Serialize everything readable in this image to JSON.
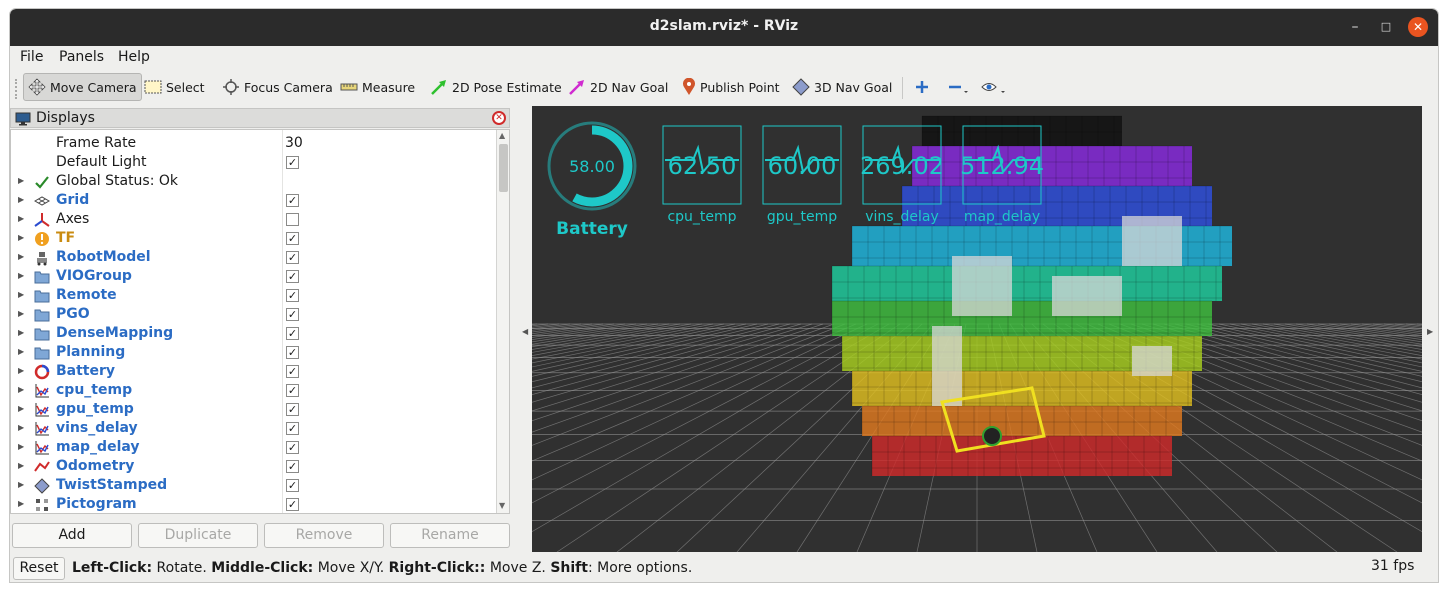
{
  "window": {
    "title": "d2slam.rviz* - RViz",
    "min_icon": "minimize-icon",
    "max_icon": "maximize-icon",
    "close_icon": "close-icon"
  },
  "menu": {
    "file": "File",
    "panels": "Panels",
    "help": "Help"
  },
  "toolbar": {
    "move_camera": "Move Camera",
    "select": "Select",
    "focus_camera": "Focus Camera",
    "measure": "Measure",
    "pose_estimate": "2D Pose Estimate",
    "nav_goal": "2D Nav Goal",
    "publish_point": "Publish Point",
    "nav_goal_3d": "3D Nav Goal"
  },
  "displays": {
    "title": "Displays",
    "rows": [
      {
        "name": "Frame Rate",
        "value": "30",
        "style": "plain",
        "icon": ""
      },
      {
        "name": "Default Light",
        "checked": true,
        "style": "plain",
        "icon": ""
      },
      {
        "name": "Global Status: Ok",
        "style": "plain",
        "icon": "check-icon",
        "expandable": true
      },
      {
        "name": "Grid",
        "checked": true,
        "style": "blue",
        "icon": "grid-icon",
        "expandable": true
      },
      {
        "name": "Axes",
        "checked": false,
        "style": "plain",
        "icon": "axes-icon",
        "expandable": true
      },
      {
        "name": "TF",
        "checked": true,
        "style": "orange",
        "icon": "warning-icon",
        "expandable": true
      },
      {
        "name": "RobotModel",
        "checked": true,
        "style": "blue",
        "icon": "robot-icon",
        "expandable": true
      },
      {
        "name": "VIOGroup",
        "checked": true,
        "style": "blue",
        "icon": "folder-icon",
        "expandable": true
      },
      {
        "name": "Remote",
        "checked": true,
        "style": "blue",
        "icon": "folder-icon",
        "expandable": true
      },
      {
        "name": "PGO",
        "checked": true,
        "style": "blue",
        "icon": "folder-icon",
        "expandable": true
      },
      {
        "name": "DenseMapping",
        "checked": true,
        "style": "blue",
        "icon": "folder-icon",
        "expandable": true
      },
      {
        "name": "Planning",
        "checked": true,
        "style": "blue",
        "icon": "folder-icon",
        "expandable": true
      },
      {
        "name": "Battery",
        "checked": true,
        "style": "blue",
        "icon": "gauge-icon",
        "expandable": true
      },
      {
        "name": "cpu_temp",
        "checked": true,
        "style": "blue",
        "icon": "plot-icon",
        "expandable": true
      },
      {
        "name": "gpu_temp",
        "checked": true,
        "style": "blue",
        "icon": "plot-icon",
        "expandable": true
      },
      {
        "name": "vins_delay",
        "checked": true,
        "style": "blue",
        "icon": "plot-icon",
        "expandable": true
      },
      {
        "name": "map_delay",
        "checked": true,
        "style": "blue",
        "icon": "plot-icon",
        "expandable": true
      },
      {
        "name": "Odometry",
        "checked": true,
        "style": "blue",
        "icon": "odometry-icon",
        "expandable": true
      },
      {
        "name": "TwistStamped",
        "checked": true,
        "style": "blue",
        "icon": "twist-icon",
        "expandable": true
      },
      {
        "name": "Pictogram",
        "checked": true,
        "style": "blue",
        "icon": "pictogram-icon",
        "expandable": true
      }
    ],
    "buttons": {
      "add": "Add",
      "duplicate": "Duplicate",
      "remove": "Remove",
      "rename": "Rename"
    }
  },
  "overlay": {
    "battery": {
      "value": "58.00",
      "label": "Battery",
      "level": 0.58
    },
    "plots": [
      {
        "value": "62.50",
        "label": "cpu_temp"
      },
      {
        "value": "60.00",
        "label": "gpu_temp"
      },
      {
        "value": "269.02",
        "label": "vins_delay"
      },
      {
        "value": "512.94",
        "label": "map_delay"
      }
    ],
    "accent": "#1ec8c8"
  },
  "status": {
    "reset": "Reset",
    "hint_left_b": "Left-Click:",
    "hint_left": " Rotate. ",
    "hint_middle_b": "Middle-Click:",
    "hint_middle": " Move X/Y. ",
    "hint_right_b": "Right-Click::",
    "hint_right": " Move Z. ",
    "hint_shift_b": "Shift",
    "hint_shift": ": More options.",
    "fps": "31 fps"
  },
  "colors": {
    "link_blue": "#2b6cc4",
    "warn_orange": "#c98b10",
    "viewport_bg": "#303030",
    "titlebar": "#2b2b2b",
    "close": "#e95420"
  }
}
